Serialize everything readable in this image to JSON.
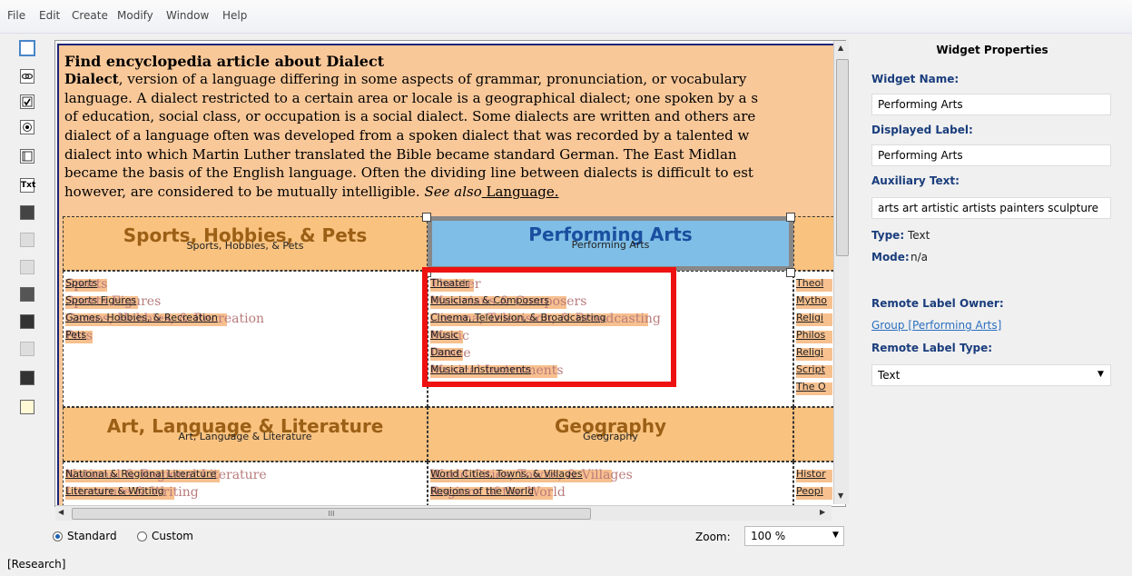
{
  "menu": [
    "File",
    "Edit",
    "Create",
    "Modify",
    "Window",
    "Help"
  ],
  "toolbar_icons": [
    "rectangle-icon",
    "link-icon",
    "checkbox-icon",
    "radio-icon",
    "frame-icon",
    "text-icon",
    "group-icon",
    "disabled-icon",
    "disabled-icon",
    "copy-icon",
    "list-icon",
    "disabled-icon",
    "panel-icon",
    "note-icon"
  ],
  "article": {
    "title": "Find encyclopedia article about Dialect",
    "term": "Dialect",
    "line1_rest": ", version of a language differing in some aspects of grammar, pronunciation, or vocabulary",
    "line2": "language. A dialect restricted to a certain area or locale is a geographical dialect; one spoken by a s",
    "line3": "of education, social class, or occupation is a social dialect. Some dialects are written and others are",
    "line4": "dialect of a language often was developed from a spoken dialect that was recorded by a talented w",
    "line5": "dialect into which Martin Luther translated the Bible became standard German. The East Midlan",
    "line6": "became the basis of the English language. Often the dividing line between dialects is difficult to est",
    "line7a": "however, are considered to be mutually intelligible. ",
    "line7b": "See also",
    "line7c": " Language."
  },
  "categories": [
    {
      "title": "Sports, Hobbies, & Pets",
      "small": "Sports, Hobbies, & Pets",
      "links": [
        {
          "fg": "Sports",
          "ghost": "Sports"
        },
        {
          "fg": "Sports Figures",
          "ghost": "Sports Figures"
        },
        {
          "fg": "Games, Hobbies, & Recreation",
          "ghost": "Games, Hobbies, & Recreation"
        },
        {
          "fg": "Pets",
          "ghost": "Pets"
        }
      ]
    },
    {
      "title": "Performing Arts",
      "small": "Performing Arts",
      "links": [
        {
          "fg": "Theater",
          "ghost": "Theater"
        },
        {
          "fg": "Musicians & Composers",
          "ghost": "Musicians & Composers"
        },
        {
          "fg": "Cinema, Television, & Broadcasting",
          "ghost": "Cinema, Television, & Broadcasting"
        },
        {
          "fg": "Music",
          "ghost": "Music"
        },
        {
          "fg": "Dance",
          "ghost": "Dance"
        },
        {
          "fg": "Musical Instruments",
          "ghost": "Musical Instruments"
        }
      ]
    },
    {
      "title": "",
      "small": "",
      "links": [
        {
          "fg": "Theol",
          "ghost": ""
        },
        {
          "fg": "Mytho",
          "ghost": ""
        },
        {
          "fg": "Religi",
          "ghost": ""
        },
        {
          "fg": "Philos",
          "ghost": ""
        },
        {
          "fg": "Religi",
          "ghost": ""
        },
        {
          "fg": "Script",
          "ghost": ""
        },
        {
          "fg": "The O",
          "ghost": ""
        }
      ]
    },
    {
      "title": "Art, Language & Literature",
      "small": "Art, Language & Literature",
      "links": [
        {
          "fg": "National & Regional Literature",
          "ghost": "National & Regional Literature"
        },
        {
          "fg": "Literature & Writing",
          "ghost": "Literature & Writing"
        }
      ]
    },
    {
      "title": "Geography",
      "small": "Geography",
      "links": [
        {
          "fg": "World Cities, Towns, & Villages",
          "ghost": "World Cities, Towns, & Villages"
        },
        {
          "fg": "Regions of the World",
          "ghost": "Regions of the World"
        }
      ]
    },
    {
      "title": "",
      "small": "",
      "links": [
        {
          "fg": "Histor",
          "ghost": ""
        },
        {
          "fg": "Peopl",
          "ghost": ""
        }
      ]
    }
  ],
  "scroll": {
    "h_thumb_label": "III"
  },
  "mode_options": {
    "standard": "Standard",
    "custom": "Custom"
  },
  "zoom": {
    "label": "Zoom:",
    "value": "100 %"
  },
  "status": "[Research]",
  "properties": {
    "heading": "Widget Properties",
    "widget_name_label": "Widget Name:",
    "widget_name": "Performing Arts",
    "displayed_label_label": "Displayed Label:",
    "displayed_label": "Performing Arts",
    "aux_text_label": "Auxiliary Text:",
    "aux_text": "arts art artistic artists painters sculpture",
    "type_label": "Type:",
    "type_value": "Text",
    "mode_label": "Mode:",
    "mode_value": "n/a",
    "remote_owner_label": "Remote Label Owner:",
    "remote_owner_link": "Group [Performing Arts]",
    "remote_type_label": "Remote Label Type:",
    "remote_type_value": "Text"
  },
  "colors": {
    "selection_box": "#ee1111",
    "selected_cell": "#7fbee6",
    "cell_orange": "#f9c27f"
  }
}
